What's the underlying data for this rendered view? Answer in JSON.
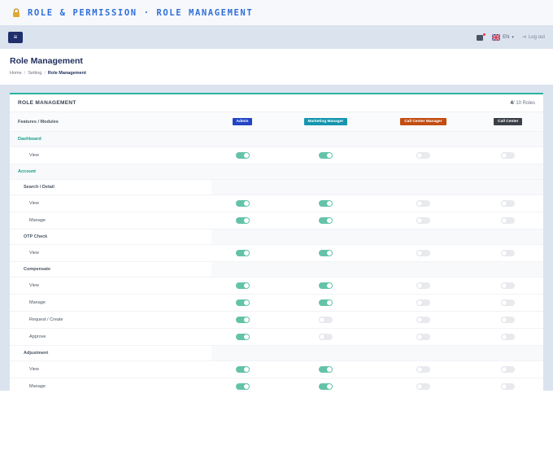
{
  "banner": {
    "title": "ROLE & PERMISSION · ROLE MANAGEMENT"
  },
  "topbar": {
    "menu_icon": "≡",
    "language": "EN",
    "logout": "Log out"
  },
  "header": {
    "title": "Role Management",
    "breadcrumb": [
      "Home",
      "Setting",
      "Role Management"
    ]
  },
  "card": {
    "title": "ROLE MANAGEMENT",
    "count_current": "4",
    "count_total": "/ 10 Roles",
    "features_label": "Features / Modules",
    "roles": [
      {
        "name": "Admin",
        "color": "#2346c5"
      },
      {
        "name": "Marketing Manager",
        "color": "#1596ae"
      },
      {
        "name": "Call Center Manager",
        "color": "#c24d12"
      },
      {
        "name": "Call Center",
        "color": "#3b3f47"
      }
    ]
  },
  "rows": [
    {
      "type": "group",
      "label": "Dashboard"
    },
    {
      "type": "perm",
      "label": "View",
      "toggles": [
        true,
        true,
        false,
        false
      ]
    },
    {
      "type": "group",
      "label": "Account"
    },
    {
      "type": "section",
      "label": "Search / Detail"
    },
    {
      "type": "perm",
      "label": "View",
      "toggles": [
        true,
        true,
        false,
        false
      ]
    },
    {
      "type": "perm",
      "label": "Manage",
      "toggles": [
        true,
        true,
        false,
        false
      ]
    },
    {
      "type": "section",
      "label": "OTP Check"
    },
    {
      "type": "perm",
      "label": "View",
      "toggles": [
        true,
        true,
        false,
        false
      ]
    },
    {
      "type": "section",
      "label": "Compensate"
    },
    {
      "type": "perm",
      "label": "View",
      "toggles": [
        true,
        true,
        false,
        false
      ]
    },
    {
      "type": "perm",
      "label": "Manage",
      "toggles": [
        true,
        true,
        false,
        false
      ]
    },
    {
      "type": "perm",
      "label": "Request / Create",
      "toggles": [
        true,
        false,
        false,
        false
      ]
    },
    {
      "type": "perm",
      "label": "Approve",
      "toggles": [
        true,
        false,
        false,
        false
      ]
    },
    {
      "type": "section",
      "label": "Adjustment"
    },
    {
      "type": "perm",
      "label": "View",
      "toggles": [
        true,
        true,
        false,
        false
      ]
    },
    {
      "type": "perm",
      "label": "Manage",
      "toggles": [
        true,
        true,
        false,
        false
      ]
    }
  ],
  "colors": {
    "accent": "#2bb3a3",
    "toggle_on": "#63c3a8",
    "toggle_off": "#e8eaee",
    "navy": "#1e2d5c"
  }
}
